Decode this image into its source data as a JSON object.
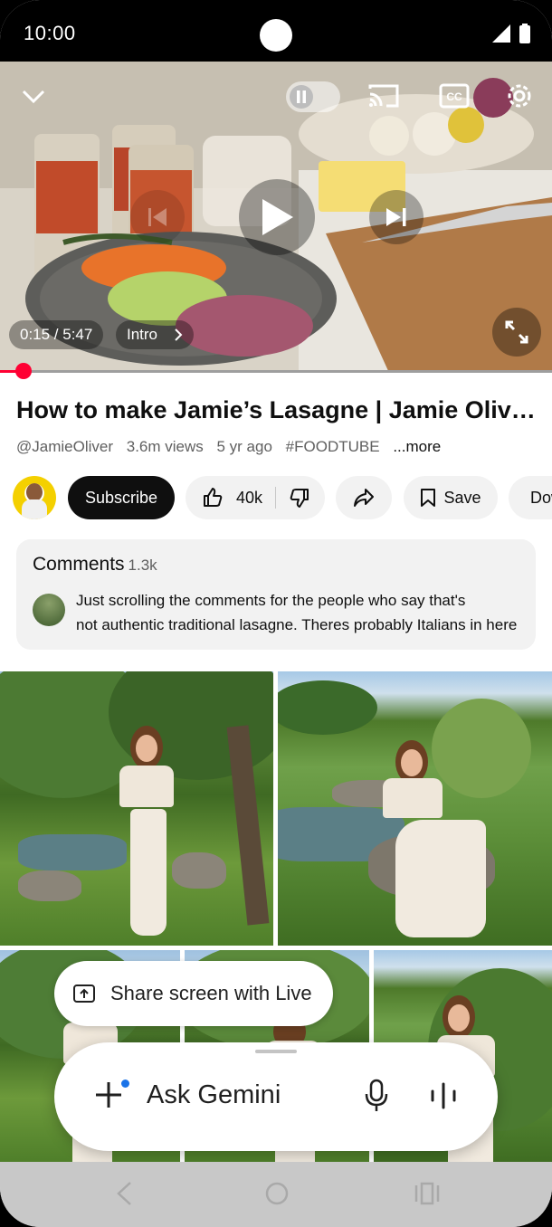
{
  "status_bar": {
    "time": "10:00"
  },
  "player": {
    "time_display": "0:15 / 5:47",
    "chapter": "Intro",
    "progress": 0.043
  },
  "video": {
    "title": "How to make Jamie’s Lasagne | Jamie Oliver | AD",
    "channel": "@JamieOliver",
    "views": "3.6m views",
    "age": "5 yr ago",
    "hashtag": "#FOODTUBE",
    "more": "...more"
  },
  "actions": {
    "subscribe": "Subscribe",
    "likes": "40k",
    "save": "Save",
    "download": "Download"
  },
  "comments": {
    "title": "Comments",
    "count": "1.3k",
    "top_line1": "Just scrolling the comments for the people who say that's",
    "top_line2": "not authentic traditional lasagne. Theres probably Italians in here"
  },
  "gemini": {
    "share_screen": "Share screen with Live",
    "ask": "Ask Gemini"
  },
  "colors": {
    "accent_red": "#ff0033",
    "gemini_blue": "#1a73e8"
  }
}
